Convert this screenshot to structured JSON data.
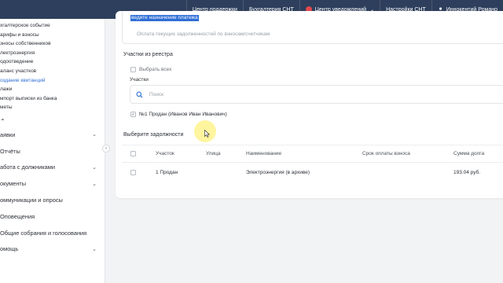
{
  "topbar": {
    "support": "Центр поддержки",
    "accounting": "Бухгалтерия СНТ",
    "notifications": "Центр уведомлений",
    "settings": "Настройки СНТ",
    "user": "Иннокентий Романо"
  },
  "sidebar": {
    "sub_items": [
      "хгалтерское событие",
      "арифы и взносы",
      "зносы собственников",
      "лектроэнергия",
      "одоотведение",
      "аланс участков",
      "оздание квитанций",
      "лажи",
      "мпорт выписки из банка",
      "меты"
    ],
    "active_sub_index": 6,
    "collapse_icon": "chevron-up-icon",
    "menu_items": [
      {
        "label": "аявки",
        "has_chevron": true
      },
      {
        "label": "Отчёты",
        "has_chevron": false
      },
      {
        "label": "абота с должниками",
        "has_chevron": true
      },
      {
        "label": "окументы",
        "has_chevron": true
      },
      {
        "label": "оммуникации и опросы",
        "has_chevron": false
      },
      {
        "label": "Оповещения",
        "has_chevron": false
      },
      {
        "label": "Общие собрания и голосования",
        "has_chevron": false
      },
      {
        "label": "омощь",
        "has_chevron": true
      }
    ]
  },
  "form": {
    "purpose_label": "ведите назначение платежа",
    "purpose_placeholder": "Оплата текущих задолженностей по взносам/счетчикам",
    "plots_section_title": "Участки из реестра",
    "select_all_label": "Выбрать всех",
    "plots_label": "Участки",
    "search_placeholder": "Поиск",
    "plot_item": "№1 Продан (Иванов Иван Иванович)",
    "plot_item_checked": true,
    "debts_section_title": "Выберите задолжности"
  },
  "debts_table": {
    "columns": [
      "Участок",
      "Улица",
      "Наименование",
      "Срок оплаты взноса",
      "Сумма долга"
    ],
    "rows": [
      {
        "plot": "1 Продан",
        "street": "",
        "name": "Электроэнергия (в архиве)",
        "due": "",
        "amount": "193.04 руб."
      }
    ]
  },
  "colors": {
    "topbar_bg": "#2d3f5c",
    "accent": "#2f6fd6",
    "notification_dot": "#e5484d",
    "cursor_highlight": "#ffec50"
  }
}
